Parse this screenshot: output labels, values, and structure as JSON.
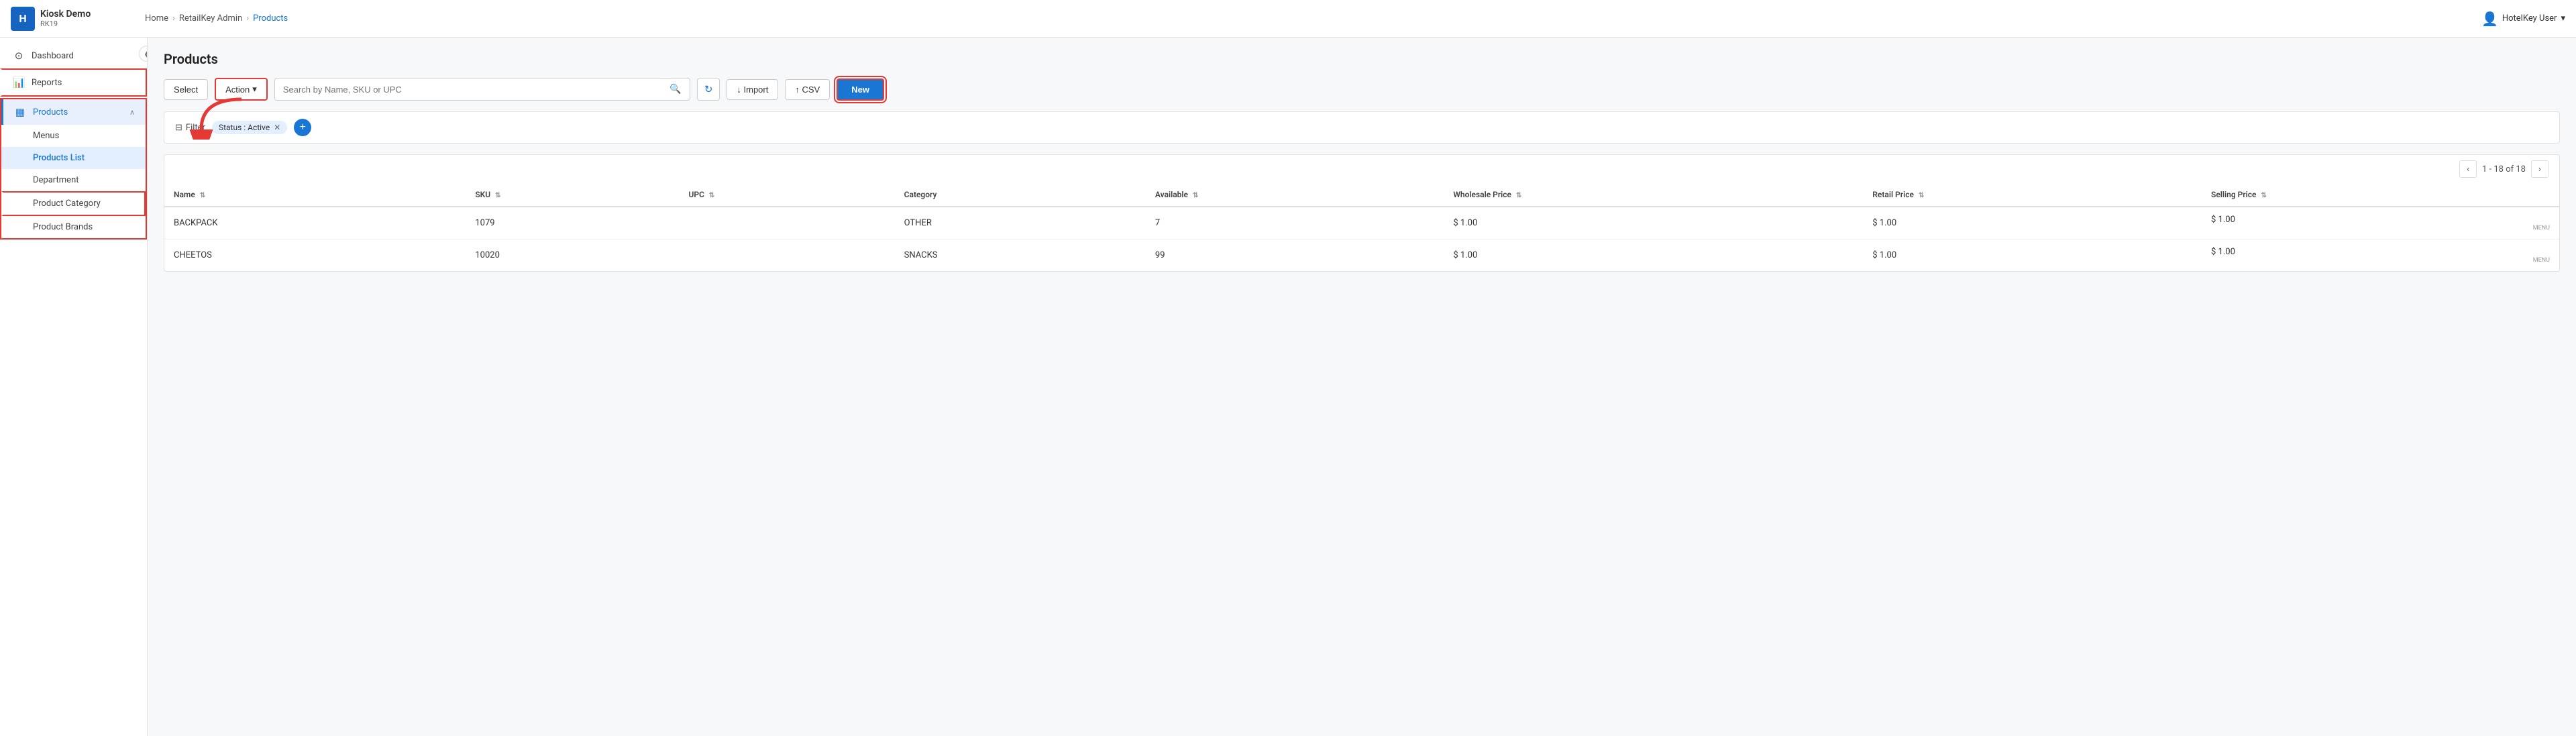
{
  "header": {
    "logo_letter": "H",
    "app_name": "Kiosk Demo",
    "app_sub": "RK19",
    "breadcrumb": [
      {
        "label": "Home",
        "active": false
      },
      {
        "label": "RetailKey Admin",
        "active": false
      },
      {
        "label": "Products",
        "active": true
      }
    ],
    "user_label": "HotelKey User"
  },
  "sidebar": {
    "collapse_icon": "❮",
    "items": [
      {
        "id": "dashboard",
        "label": "Dashboard",
        "icon": "⊙",
        "active": false
      },
      {
        "id": "reports",
        "label": "Reports",
        "icon": "📊",
        "active": false
      },
      {
        "id": "products",
        "label": "Products",
        "icon": "▦",
        "active": true,
        "expanded": true
      }
    ],
    "sub_items": [
      {
        "id": "menus",
        "label": "Menus",
        "active": false
      },
      {
        "id": "products-list",
        "label": "Products List",
        "active": true
      },
      {
        "id": "department",
        "label": "Department",
        "active": false
      },
      {
        "id": "product-category",
        "label": "Product Category",
        "active": false
      },
      {
        "id": "product-brands",
        "label": "Product Brands",
        "active": false
      }
    ]
  },
  "page": {
    "title": "Products"
  },
  "toolbar": {
    "select_label": "Select",
    "action_label": "Action",
    "action_arrow": "▾",
    "search_placeholder": "Search by Name, SKU or UPC",
    "import_label": "↓ Import",
    "csv_label": "↑ CSV",
    "new_label": "New",
    "refresh_icon": "↻"
  },
  "filter": {
    "filter_label": "Filter",
    "chip_label": "Status : Active",
    "add_icon": "+"
  },
  "table": {
    "pagination": "1 - 18 of 18",
    "columns": [
      {
        "id": "name",
        "label": "Name"
      },
      {
        "id": "sku",
        "label": "SKU"
      },
      {
        "id": "upc",
        "label": "UPC"
      },
      {
        "id": "category",
        "label": "Category"
      },
      {
        "id": "available",
        "label": "Available"
      },
      {
        "id": "wholesale_price",
        "label": "Wholesale Price"
      },
      {
        "id": "retail_price",
        "label": "Retail Price"
      },
      {
        "id": "selling_price",
        "label": "Selling Price"
      }
    ],
    "rows": [
      {
        "name": "BACKPACK",
        "sku": "1079",
        "upc": "",
        "category": "OTHER",
        "available": "7",
        "wholesale_price": "$ 1.00",
        "retail_price": "$ 1.00",
        "selling_price": "$ 1.00",
        "selling_badge": "MENU"
      },
      {
        "name": "CHEETOS",
        "sku": "10020",
        "upc": "",
        "category": "SNACKS",
        "available": "99",
        "wholesale_price": "$ 1.00",
        "retail_price": "$ 1.00",
        "selling_price": "$ 1.00",
        "selling_badge": "MENU"
      }
    ]
  }
}
